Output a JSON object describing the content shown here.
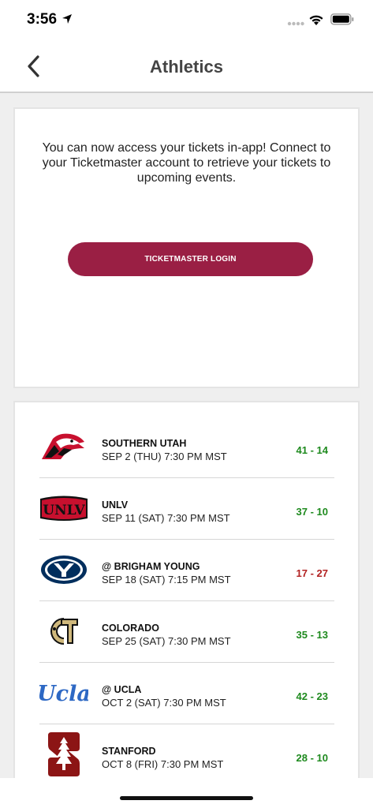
{
  "status": {
    "time": "3:56"
  },
  "nav": {
    "title": "Athletics",
    "back_icon": "chevron-left-icon"
  },
  "tickets": {
    "message": "You can now access your tickets in-app! Connect to your Ticketmaster account to retrieve your tickets to upcoming events.",
    "login_label": "TICKETMASTER LOGIN",
    "button_color": "#9a1f44"
  },
  "games": [
    {
      "opponent": "SOUTHERN UTAH",
      "date": "SEP 2 (THU) 7:30 PM MST",
      "score": "41 - 14",
      "result": "win",
      "logo": "southern-utah-logo"
    },
    {
      "opponent": "UNLV",
      "date": "SEP 11 (SAT) 7:30 PM MST",
      "score": "37 - 10",
      "result": "win",
      "logo": "unlv-logo"
    },
    {
      "opponent": "@ BRIGHAM YOUNG",
      "date": "SEP 18 (SAT) 7:15 PM MST",
      "score": "17 - 27",
      "result": "loss",
      "logo": "byu-logo"
    },
    {
      "opponent": "COLORADO",
      "date": "SEP 25 (SAT) 7:30 PM MST",
      "score": "35 - 13",
      "result": "win",
      "logo": "colorado-logo"
    },
    {
      "opponent": "@ UCLA",
      "date": "OCT 2 (SAT) 7:30 PM MST",
      "score": "42 - 23",
      "result": "win",
      "logo": "ucla-logo"
    },
    {
      "opponent": "STANFORD",
      "date": "OCT 8 (FRI) 7:30 PM MST",
      "score": "28 - 10",
      "result": "win",
      "logo": "stanford-logo"
    }
  ],
  "colors": {
    "win": "#1e8a1e",
    "loss": "#b22222"
  }
}
